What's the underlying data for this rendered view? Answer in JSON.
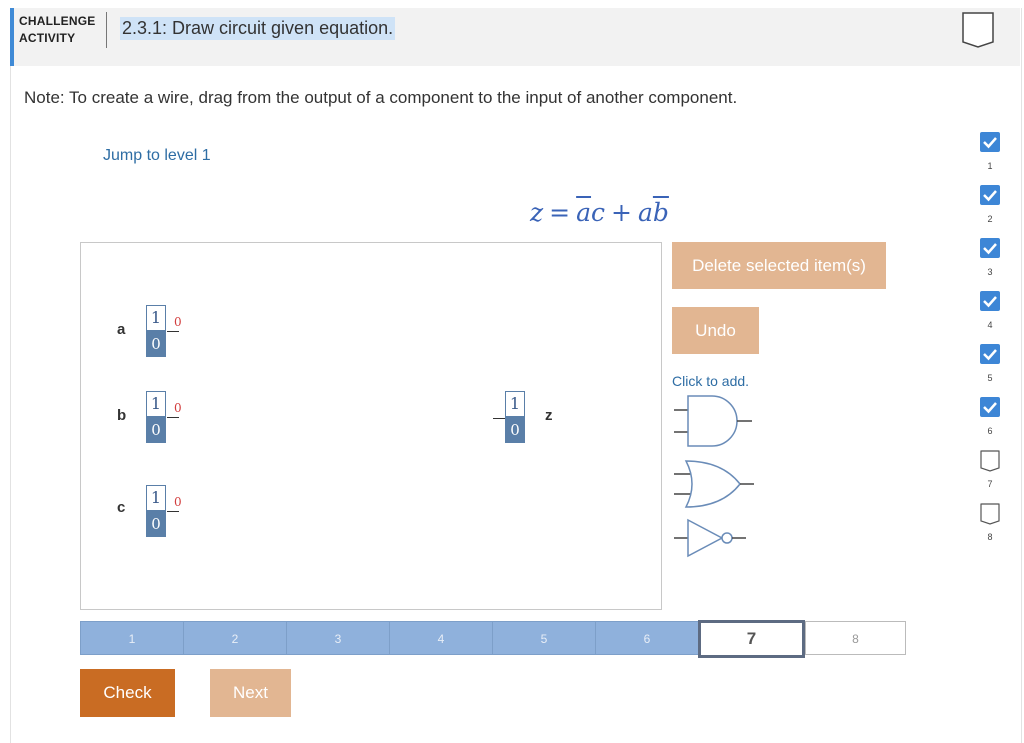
{
  "header": {
    "label_line1": "CHALLENGE",
    "label_line2": "ACTIVITY",
    "title": "2.3.1: Draw circuit given equation."
  },
  "note": "Note: To create a wire, drag from the output of a component to the input of another component.",
  "jump_link": "Jump to level 1",
  "equation": {
    "lhs": "z",
    "eq": "=",
    "t1a": "a",
    "t1b": "c",
    "plus": "+",
    "t2a": "a",
    "t2b": "b"
  },
  "canvas": {
    "inputs": [
      {
        "name": "a",
        "top": "1",
        "bottom": "0",
        "output": "0"
      },
      {
        "name": "b",
        "top": "1",
        "bottom": "0",
        "output": "0"
      },
      {
        "name": "c",
        "top": "1",
        "bottom": "0",
        "output": "0"
      }
    ],
    "output": {
      "name": "z",
      "top": "1",
      "bottom": "0"
    }
  },
  "buttons": {
    "delete": "Delete selected item(s)",
    "undo": "Undo",
    "check": "Check",
    "next": "Next"
  },
  "palette": {
    "label": "Click to add.",
    "gates": [
      "and-gate",
      "or-gate",
      "not-gate"
    ]
  },
  "levels": [
    "1",
    "2",
    "3",
    "4",
    "5",
    "6",
    "7",
    "8"
  ],
  "current_level": "7",
  "progress_sidebar": [
    {
      "num": "1",
      "done": true
    },
    {
      "num": "2",
      "done": true
    },
    {
      "num": "3",
      "done": true
    },
    {
      "num": "4",
      "done": true
    },
    {
      "num": "5",
      "done": true
    },
    {
      "num": "6",
      "done": true
    },
    {
      "num": "7",
      "done": false
    },
    {
      "num": "8",
      "done": false
    }
  ],
  "colors": {
    "accent": "#3f8ad6",
    "check_button": "#c96c23",
    "secondary_button": "#e2b692",
    "link": "#2e6da4",
    "level_done": "#8fb1dc"
  }
}
